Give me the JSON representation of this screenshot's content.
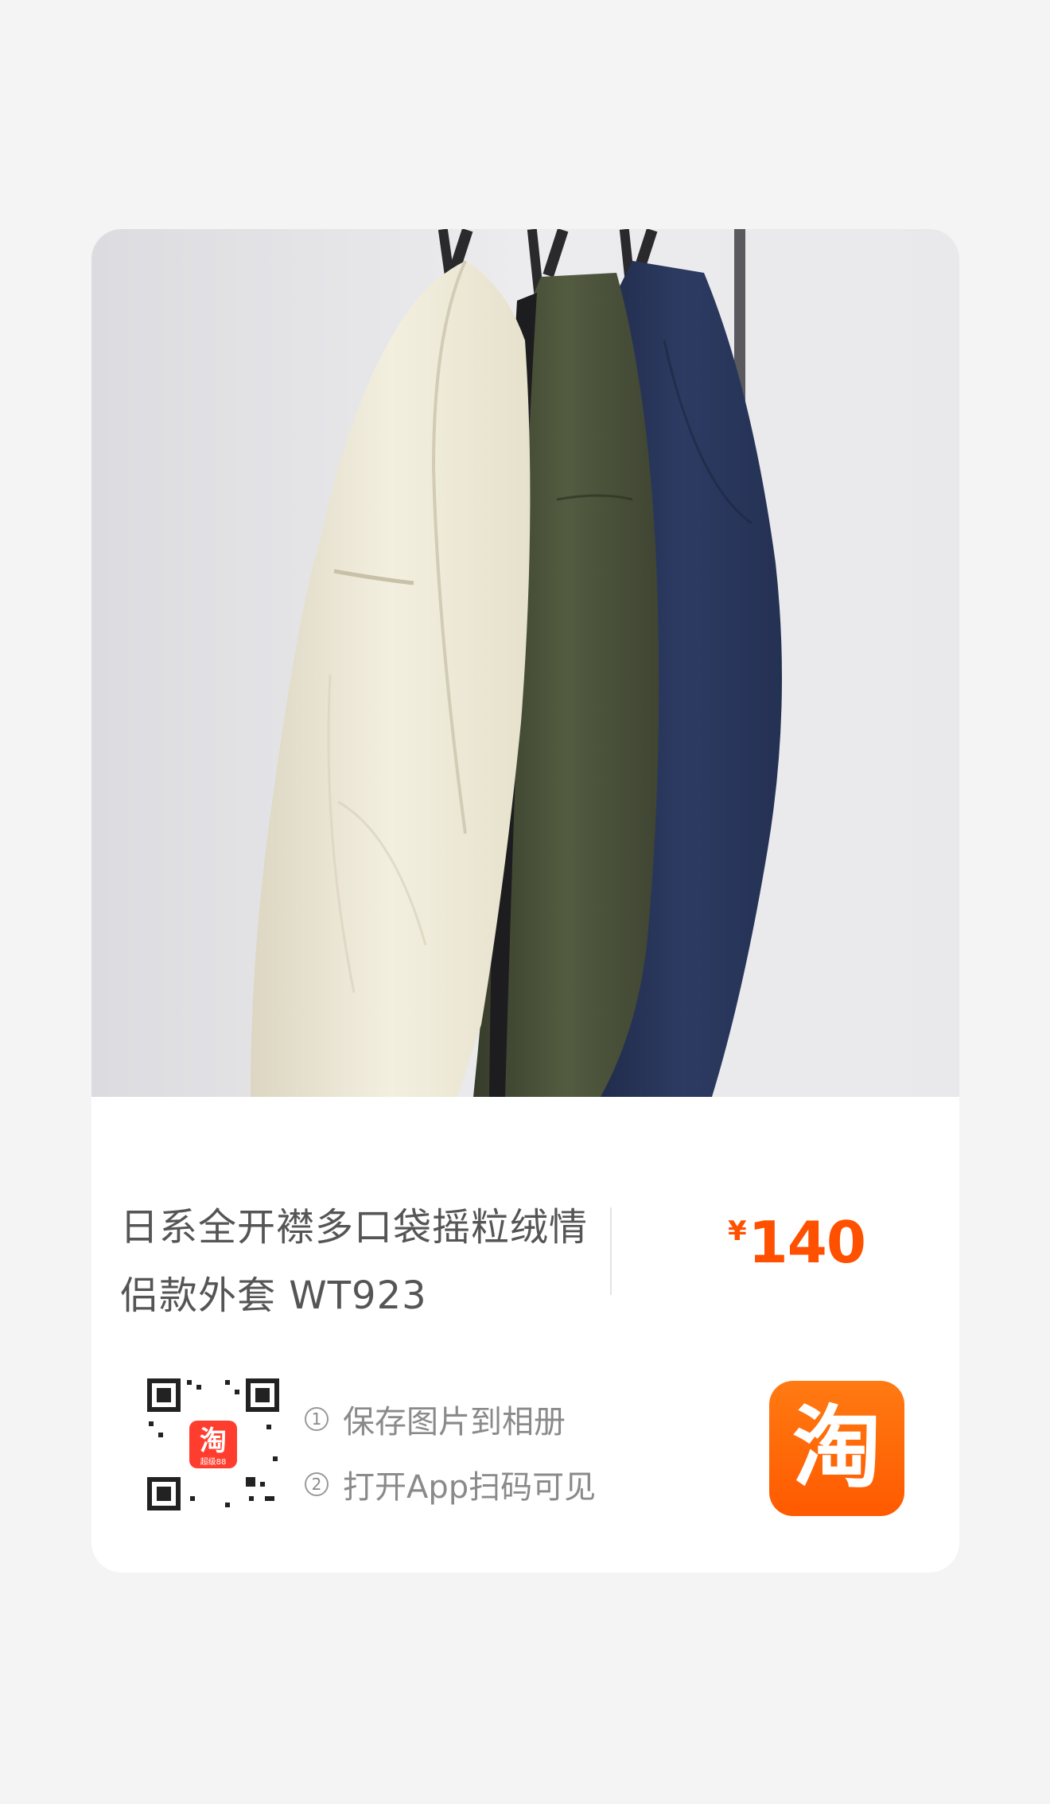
{
  "product": {
    "title": "日系全开襟多口袋摇粒绒情侣款外套 WT923",
    "price_symbol": "¥",
    "price": "140"
  },
  "share": {
    "qr_badge_text": "淘",
    "qr_badge_sub": "超级88",
    "steps": [
      {
        "num": "1",
        "text": "保存图片到相册"
      },
      {
        "num": "2",
        "text": "打开App扫码可见"
      }
    ]
  },
  "logo": {
    "glyph": "淘"
  },
  "colors": {
    "price": "#ff5000",
    "brand": "#ff5a00",
    "jacket_cream": "#efebdb",
    "jacket_olive": "#4a5139",
    "jacket_navy": "#273559"
  },
  "icons": [
    "hanger-icon",
    "qr-code-icon",
    "taobao-logo-icon"
  ]
}
